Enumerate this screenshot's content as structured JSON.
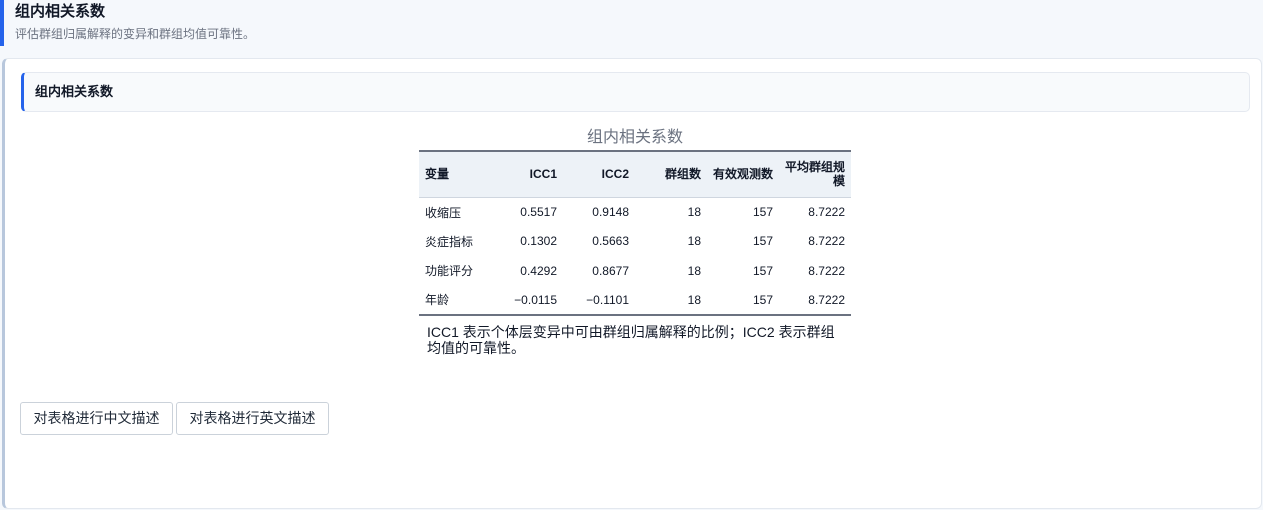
{
  "header": {
    "title": "组内相关系数",
    "subtitle": "评估群组归属解释的变异和群组均值可靠性。"
  },
  "section": {
    "title": "组内相关系数"
  },
  "table": {
    "caption": "组内相关系数",
    "columns": [
      "变量",
      "ICC1",
      "ICC2",
      "群组数",
      "有效观测数",
      "平均群组规模"
    ],
    "rows": [
      [
        "收缩压",
        "0.5517",
        "0.9148",
        "18",
        "157",
        "8.7222"
      ],
      [
        "炎症指标",
        "0.1302",
        "0.5663",
        "18",
        "157",
        "8.7222"
      ],
      [
        "功能评分",
        "0.4292",
        "0.8677",
        "18",
        "157",
        "8.7222"
      ],
      [
        "年龄",
        "−0.0115",
        "−0.1101",
        "18",
        "157",
        "8.7222"
      ]
    ],
    "note": "ICC1 表示个体层变异中可由群组归属解释的比例；ICC2 表示群组均值的可靠性。"
  },
  "buttons": {
    "describe_cn": "对表格进行中文描述",
    "describe_en": "对表格进行英文描述"
  }
}
